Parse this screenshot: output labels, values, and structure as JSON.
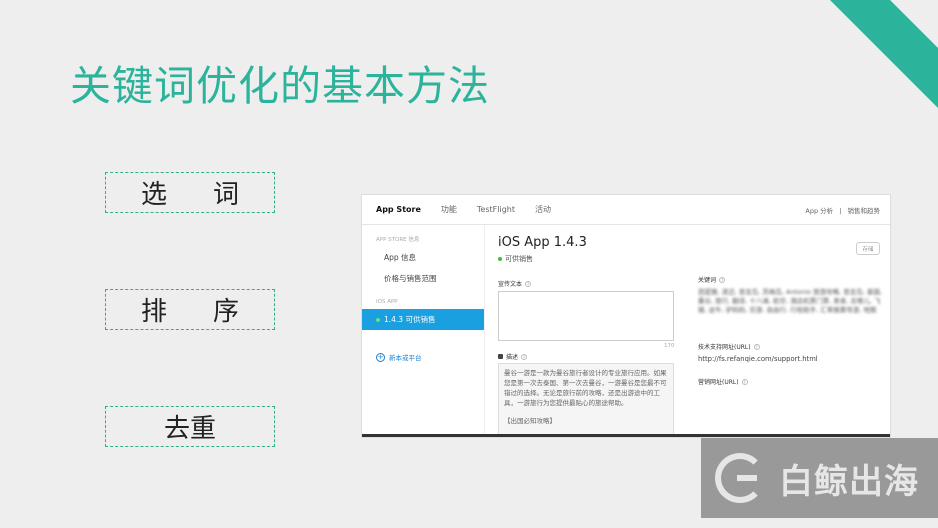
{
  "slide": {
    "title": "关键词优化的基本方法",
    "methods": [
      {
        "part1": "选",
        "part2": "词"
      },
      {
        "part1": "排",
        "part2": "序"
      },
      {
        "part1": "去重",
        "part2": ""
      }
    ]
  },
  "screenshot": {
    "nav_tabs": [
      "App Store",
      "功能",
      "TestFlight",
      "活动"
    ],
    "nav_right": [
      "App 分析",
      "|",
      "销售和趋势"
    ],
    "sidebar": {
      "section1": "APP STORE 信息",
      "items1": [
        "App 信息",
        "价格与销售范围"
      ],
      "section2": "IOS APP",
      "active_item": "1.4.3 可供销售",
      "add_platform": "新本或平台"
    },
    "app_title": "iOS App 1.4.3",
    "app_status": "可供销售",
    "save_label": "存储",
    "promo_label": "宣传文本",
    "promo_count": "170",
    "desc_label": "描述",
    "desc_text": "曼谷一游是一款为曼谷旅行者设计的专业旅行应用。如果您是第一次去泰国、第一次去曼谷，一游曼谷是您最不可错过的选择。无论是旅行前的攻略，还是出游途中的工具，一游旅行为您提供最贴心的旅途帮助。",
    "desc_tag": "【出国必知攻略】",
    "keywords_label": "关键词",
    "keywords_text": "芭提雅, 清迈, 普吉岛, 苏梅岛, Antonio 旅游攻略, 普吉岛, 泰国, 曼谷, 旅行, 翻译, 十八滩, 航空, 酒店机票门票, 美食, 去哪儿, 飞猪, 途牛, 驴妈妈, 穷游, 自由行, 行程助手, 汇率换算导游, 地图",
    "support_label": "技术支持网址(URL)",
    "support_url": "http://fs.refanqie.com/support.html",
    "marketing_label": "营销网址(URL)"
  },
  "watermark": {
    "text": "白鲸出海"
  },
  "colors": {
    "accent": "#2bb39b",
    "box_border": "#34b07f",
    "active_blue": "#1a9fe0"
  }
}
